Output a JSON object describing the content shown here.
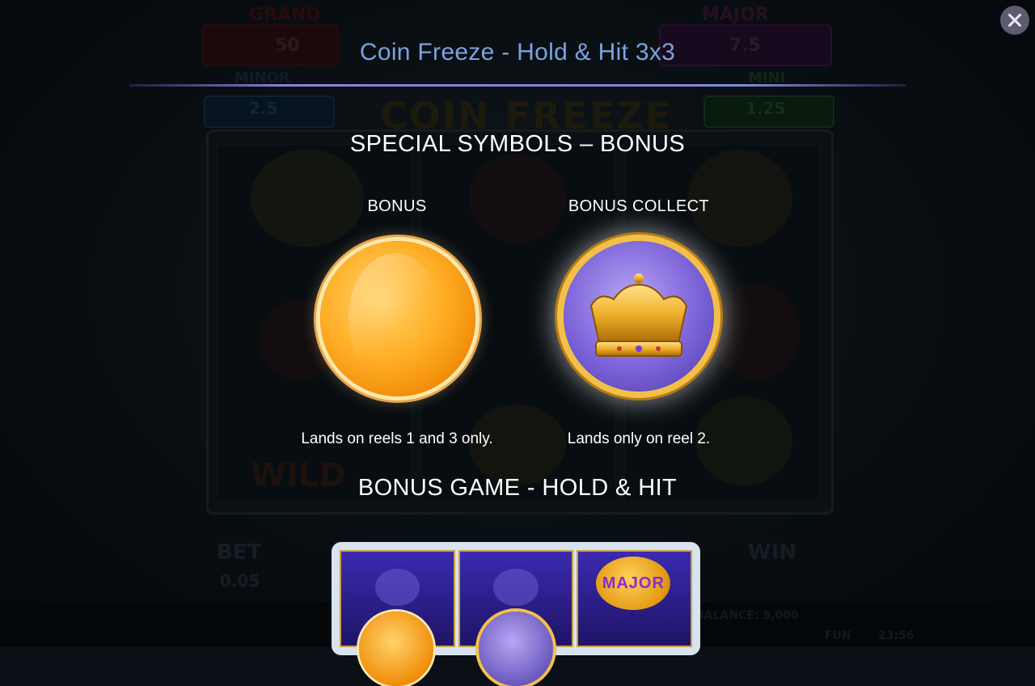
{
  "window": {
    "title": "Coin Freeze - Hold & Hit 3x3",
    "close_label": "close"
  },
  "sections": {
    "special_symbols_heading": "SPECIAL SYMBOLS – BONUS",
    "bonus_game_heading": "BONUS GAME - HOLD & HIT"
  },
  "symbols": [
    {
      "label": "BONUS",
      "description": "Lands on reels 1 and 3 only.",
      "icon": "bonus-coin-icon"
    },
    {
      "label": "BONUS COLLECT",
      "description": "Lands only on reel 2.",
      "icon": "crown-coin-icon"
    }
  ],
  "mini_grid": {
    "jackpot_label": "MAJOR"
  },
  "background": {
    "jackpots": [
      {
        "label": "GRAND",
        "value": "50"
      },
      {
        "label": "MAJOR",
        "value": "7.5"
      },
      {
        "label": "MINOR",
        "value": "2.5"
      },
      {
        "label": "MINI",
        "value": "1.25"
      }
    ],
    "logo": "COIN FREEZE",
    "bet_label": "BET",
    "bet_value": "0.05",
    "win_label": "WIN",
    "balance": "BALANCE: 5,000",
    "mode": "FUN",
    "time": "23:56",
    "wild_label": "WILD"
  },
  "colors": {
    "title": "#7aa3de",
    "divider": "#8a7fe0",
    "close_button": "#5d5a72"
  }
}
